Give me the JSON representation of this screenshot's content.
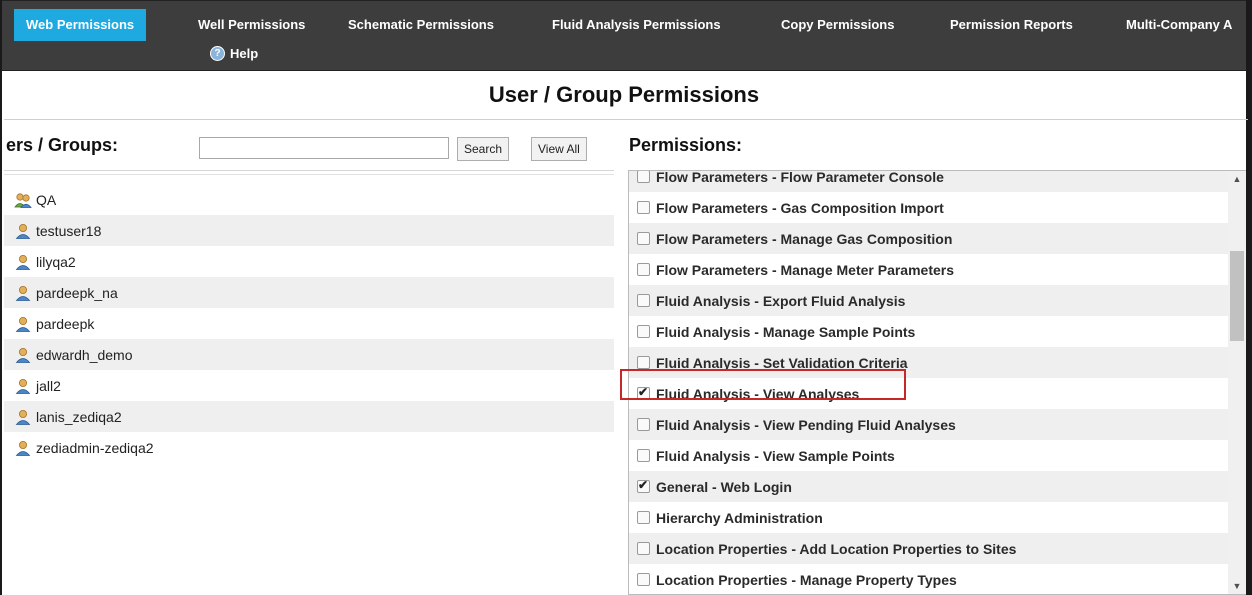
{
  "nav": {
    "tabs": [
      {
        "label": "Web Permissions",
        "active": true
      },
      {
        "label": "Well Permissions"
      },
      {
        "label": "Schematic Permissions"
      },
      {
        "label": "Fluid Analysis Permissions"
      },
      {
        "label": "Copy Permissions"
      },
      {
        "label": "Permission Reports"
      },
      {
        "label": "Multi-Company A"
      }
    ],
    "help_label": "Help",
    "help_icon": "question-circle-icon",
    "active_color": "#1ea9e1"
  },
  "page_title": "User / Group Permissions",
  "left": {
    "heading": "ers / Groups:",
    "search": {
      "value": "",
      "placeholder": ""
    },
    "search_button": "Search",
    "view_all_button": "View All",
    "users": [
      {
        "name": "QA",
        "icon": "group-icon"
      },
      {
        "name": "testuser18",
        "icon": "user-icon"
      },
      {
        "name": "lilyqa2",
        "icon": "user-icon"
      },
      {
        "name": "pardeepk_na",
        "icon": "user-icon"
      },
      {
        "name": "pardeepk",
        "icon": "user-icon"
      },
      {
        "name": "edwardh_demo",
        "icon": "user-icon"
      },
      {
        "name": "jall2",
        "icon": "user-icon"
      },
      {
        "name": "lanis_zediqa2",
        "icon": "user-icon"
      },
      {
        "name": "zediadmin-zediqa2",
        "icon": "user-icon"
      }
    ]
  },
  "right": {
    "heading": "Permissions:",
    "permissions": [
      {
        "label": "Flow Parameters - Flow Parameter Console",
        "checked": false
      },
      {
        "label": "Flow Parameters - Gas Composition Import",
        "checked": false
      },
      {
        "label": "Flow Parameters - Manage Gas Composition",
        "checked": false
      },
      {
        "label": "Flow Parameters - Manage Meter Parameters",
        "checked": false
      },
      {
        "label": "Fluid Analysis - Export Fluid Analysis",
        "checked": false
      },
      {
        "label": "Fluid Analysis - Manage Sample Points",
        "checked": false
      },
      {
        "label": "Fluid Analysis - Set Validation Criteria",
        "checked": false
      },
      {
        "label": "Fluid Analysis - View Analyses",
        "checked": true,
        "highlighted": true
      },
      {
        "label": "Fluid Analysis - View Pending Fluid Analyses",
        "checked": false
      },
      {
        "label": "Fluid Analysis - View Sample Points",
        "checked": false
      },
      {
        "label": "General - Web Login",
        "checked": true
      },
      {
        "label": "Hierarchy Administration",
        "checked": false
      },
      {
        "label": "Location Properties - Add Location Properties to Sites",
        "checked": false
      },
      {
        "label": "Location Properties - Manage Property Types",
        "checked": false
      }
    ],
    "highlight_color": "#c62828"
  }
}
